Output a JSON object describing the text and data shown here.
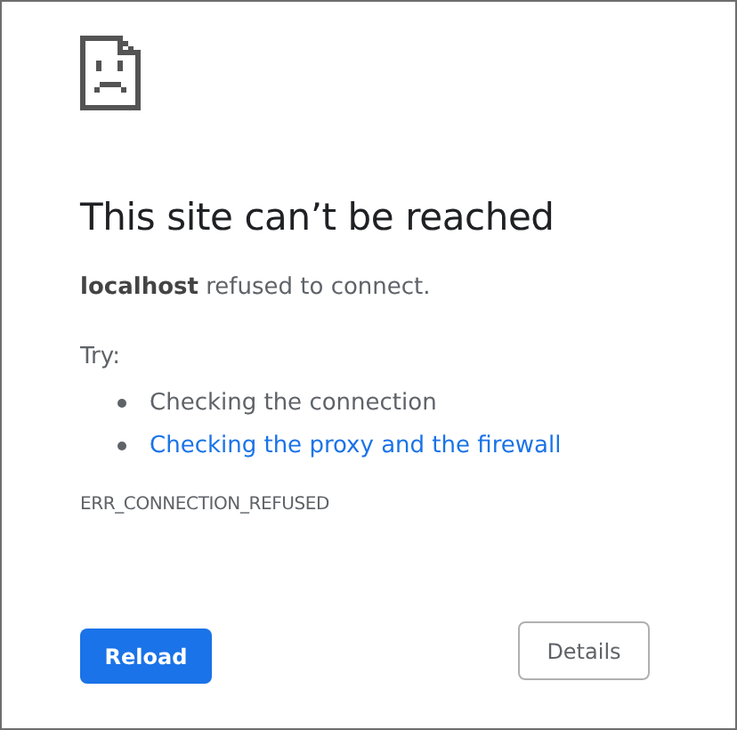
{
  "heading": "This site can’t be reached",
  "message": "**localhost** refused to connect.",
  "suggestions_title": "Try:",
  "suggestions": [
    {
      "kind": "text",
      "label": "Checking the connection"
    },
    {
      "kind": "link",
      "label": "Checking the proxy and the firewall"
    }
  ],
  "error_code": "ERR_CONNECTION_REFUSED",
  "buttons": [
    {
      "kind": "primary",
      "label": "Reload"
    },
    {
      "kind": "secondary",
      "label": "Details"
    }
  ]
}
